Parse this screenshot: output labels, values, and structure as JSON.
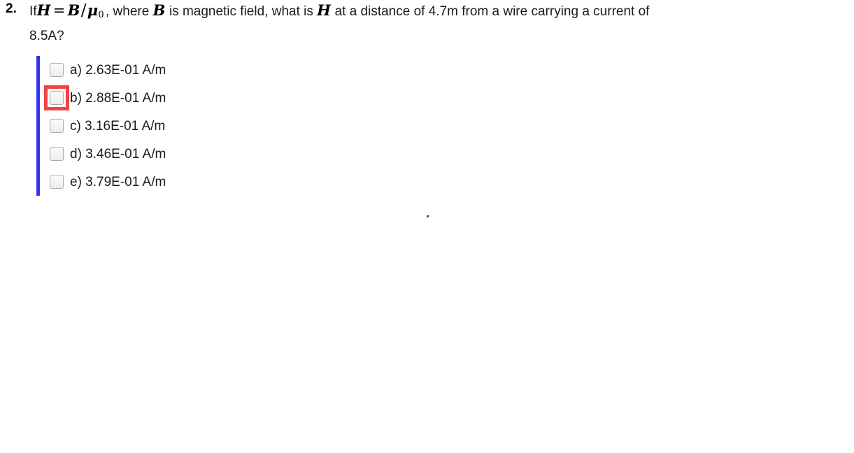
{
  "question": {
    "number": "2.",
    "text_parts": {
      "intro": "If",
      "math_h1": "H",
      "math_eq": "=",
      "math_b1": "B",
      "math_slash": "/",
      "math_mu": "μ",
      "math_mu_sub": "0",
      "after_math": ", where",
      "math_b2": "B",
      "mid": "is magnetic field, what is",
      "math_h2": "H",
      "tail": "at a distance of 4.7m from a wire carrying a current of",
      "line2": "8.5A?"
    },
    "full_text": "If H = B/μ₀, where B is magnetic field, what is H at a distance of 4.7m from a wire carrying a current of 8.5A?"
  },
  "options": [
    {
      "id": "a",
      "label": "a) 2.63E-01 A/m",
      "value": "2.63E-01 A/m",
      "checked": false,
      "highlighted": false
    },
    {
      "id": "b",
      "label": "b) 2.88E-01 A/m",
      "value": "2.88E-01 A/m",
      "checked": false,
      "highlighted": true
    },
    {
      "id": "c",
      "label": "c) 3.16E-01 A/m",
      "value": "3.16E-01 A/m",
      "checked": false,
      "highlighted": false
    },
    {
      "id": "d",
      "label": "d) 3.46E-01 A/m",
      "value": "3.46E-01 A/m",
      "checked": false,
      "highlighted": false
    },
    {
      "id": "e",
      "label": "e) 3.79E-01 A/m",
      "value": "3.79E-01 A/m",
      "checked": false,
      "highlighted": false
    }
  ],
  "colors": {
    "option_bar": "#3333ee",
    "highlight_box": "#f54242",
    "text": "#1b1b1b",
    "background": "#ffffff",
    "checkbox_border": "#a9a9a9"
  }
}
